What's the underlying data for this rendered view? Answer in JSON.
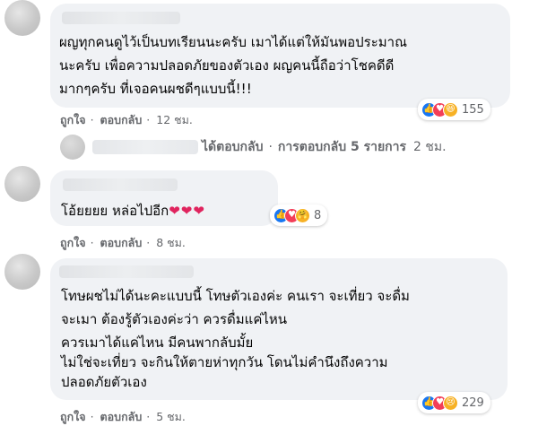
{
  "comments": [
    {
      "lines": [
        "ผญทุกคนดูไว้เป็นบทเรียนนะครับ เมาได้แต่ให้มันพอประมาณ",
        "นะครับ เพื่อความปลอดภัยของตัวเอง ผญคนนี้ถือว่าโชคดีดี",
        "มากๆครับ ที่เจอคนผชดีๆแบบนี้!!!"
      ],
      "like_label": "ถูกใจ",
      "reply_label": "ตอบกลับ",
      "time": "12 ชม.",
      "reactions": [
        "like",
        "love",
        "haha"
      ],
      "reaction_count": "155"
    },
    {
      "lines": [
        "โอ้ยยยย หล่อไปอีก"
      ],
      "emoji": "❤❤❤",
      "like_label": "ถูกใจ",
      "reply_label": "ตอบกลับ",
      "time": "8 ชม.",
      "reactions": [
        "like",
        "love",
        "care"
      ],
      "reaction_count": "8"
    },
    {
      "lines": [
        "โทษผชไม่ได้นะคะแบบนี้ โทษตัวเองค่ะ คนเรา จะเที่ยว จะดื่ม",
        "จะเมา ต้องรู้ตัวเองค่ะว่า ควรดื่มแค่ไหน",
        "ควรเมาได้แค่ไหน มีคนพากลับมั้ย",
        "ไม่ใช่จะเที่ยว จะกินให้ตายห่าทุกวัน โดนไม่คำนึงถึงความ",
        "ปลอดภัยตัวเอง"
      ],
      "like_label": "ถูกใจ",
      "reply_label": "ตอบกลับ",
      "time": "5 ชม.",
      "reactions": [
        "like",
        "love",
        "sad"
      ],
      "reaction_count": "229"
    }
  ],
  "replies": {
    "replied_label": "ได้ตอบกลับ",
    "separator": "·",
    "count_label": "การตอบกลับ 5 รายการ",
    "time": "2 ชม."
  },
  "colors": {
    "bubble": "#f0f2f5",
    "meta": "#65676b",
    "like": "#1877f2",
    "love": "#f33e58",
    "haha": "#f7b125"
  }
}
